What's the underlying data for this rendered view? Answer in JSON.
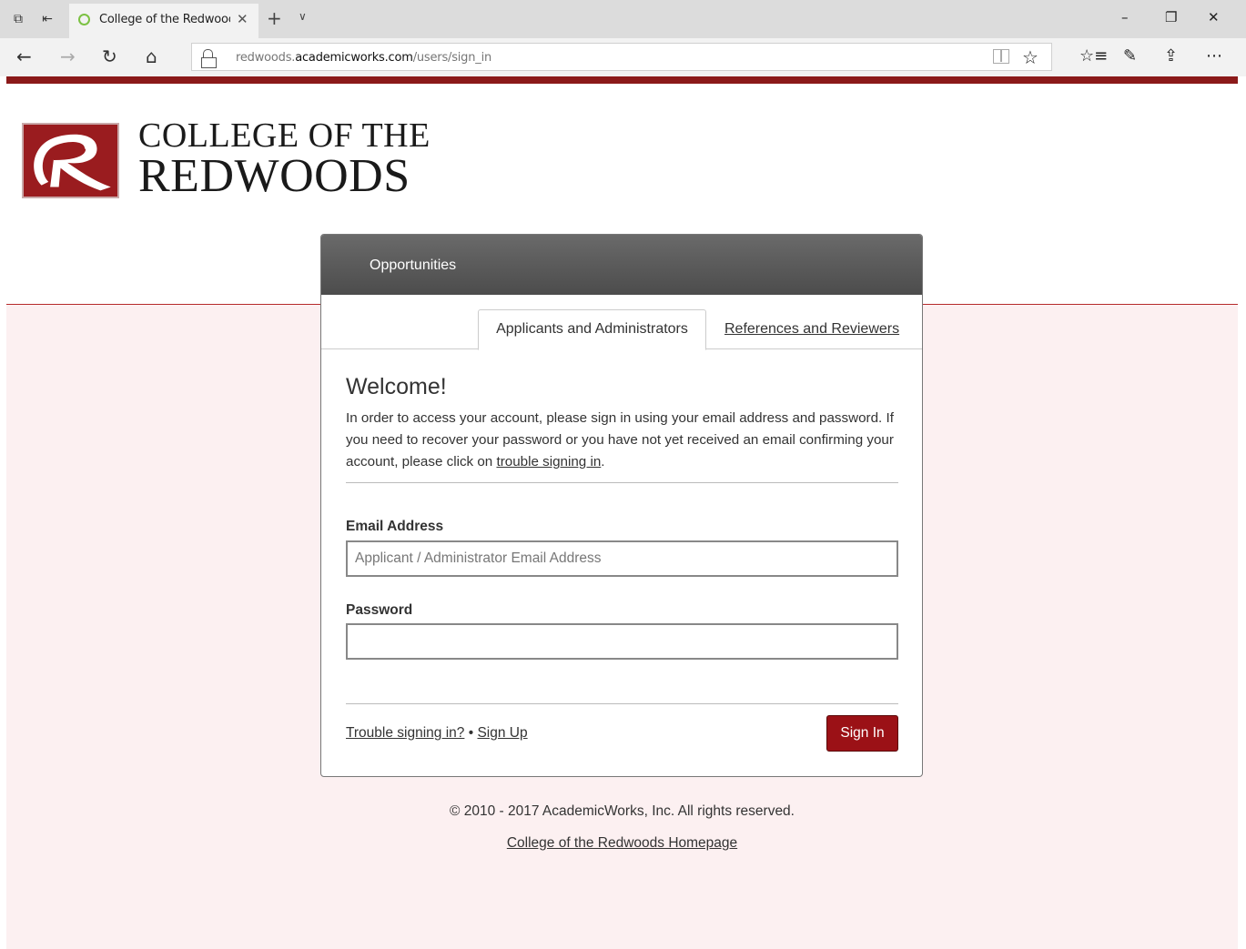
{
  "browser": {
    "tab_title": "College of the Redwooc",
    "url_prefix": "redwoods.",
    "url_domain": "academicworks.com",
    "url_path": "/users/sign_in",
    "icons": {
      "tab_actions": "⧉",
      "tab_aside": "⇤",
      "close_tab": "✕",
      "new_tab": "+",
      "tab_list": "∨",
      "minimize": "–",
      "restore": "❐",
      "close_window": "✕",
      "back": "←",
      "forward": "→",
      "refresh": "↻",
      "home": "⌂",
      "favorite": "☆",
      "favorites_hub": "☆≡",
      "notes": "✎",
      "share": "⇪",
      "more": "⋯"
    }
  },
  "brand": {
    "line1": "COLLEGE OF THE",
    "line2": "REDWOODS"
  },
  "card": {
    "header_label": "Opportunities",
    "tabs": [
      {
        "label": "Applicants and Administrators",
        "active": true
      },
      {
        "label": "References and Reviewers",
        "active": false
      }
    ],
    "welcome": "Welcome!",
    "intro_text": "In order to access your account, please sign in using your email address and password. If you need to recover your password or you have not yet received an email confirming your account, please click on ",
    "intro_link": "trouble signing in",
    "intro_end": ".",
    "email_label": "Email Address",
    "email_placeholder": "Applicant / Administrator Email Address",
    "email_value": "",
    "password_label": "Password",
    "password_value": "",
    "trouble_link": "Trouble signing in?",
    "separator": "•",
    "signup_link": "Sign Up",
    "signin_button": "Sign In"
  },
  "footer": {
    "copyright": "© 2010 - 2017 AcademicWorks, Inc. All rights reserved.",
    "home_link": "College of the Redwoods Homepage"
  },
  "colors": {
    "brand_red": "#8b1a1a",
    "button_red": "#9b1116",
    "page_pink": "#fcf0f1",
    "header_gray": "#5a5a5a"
  }
}
